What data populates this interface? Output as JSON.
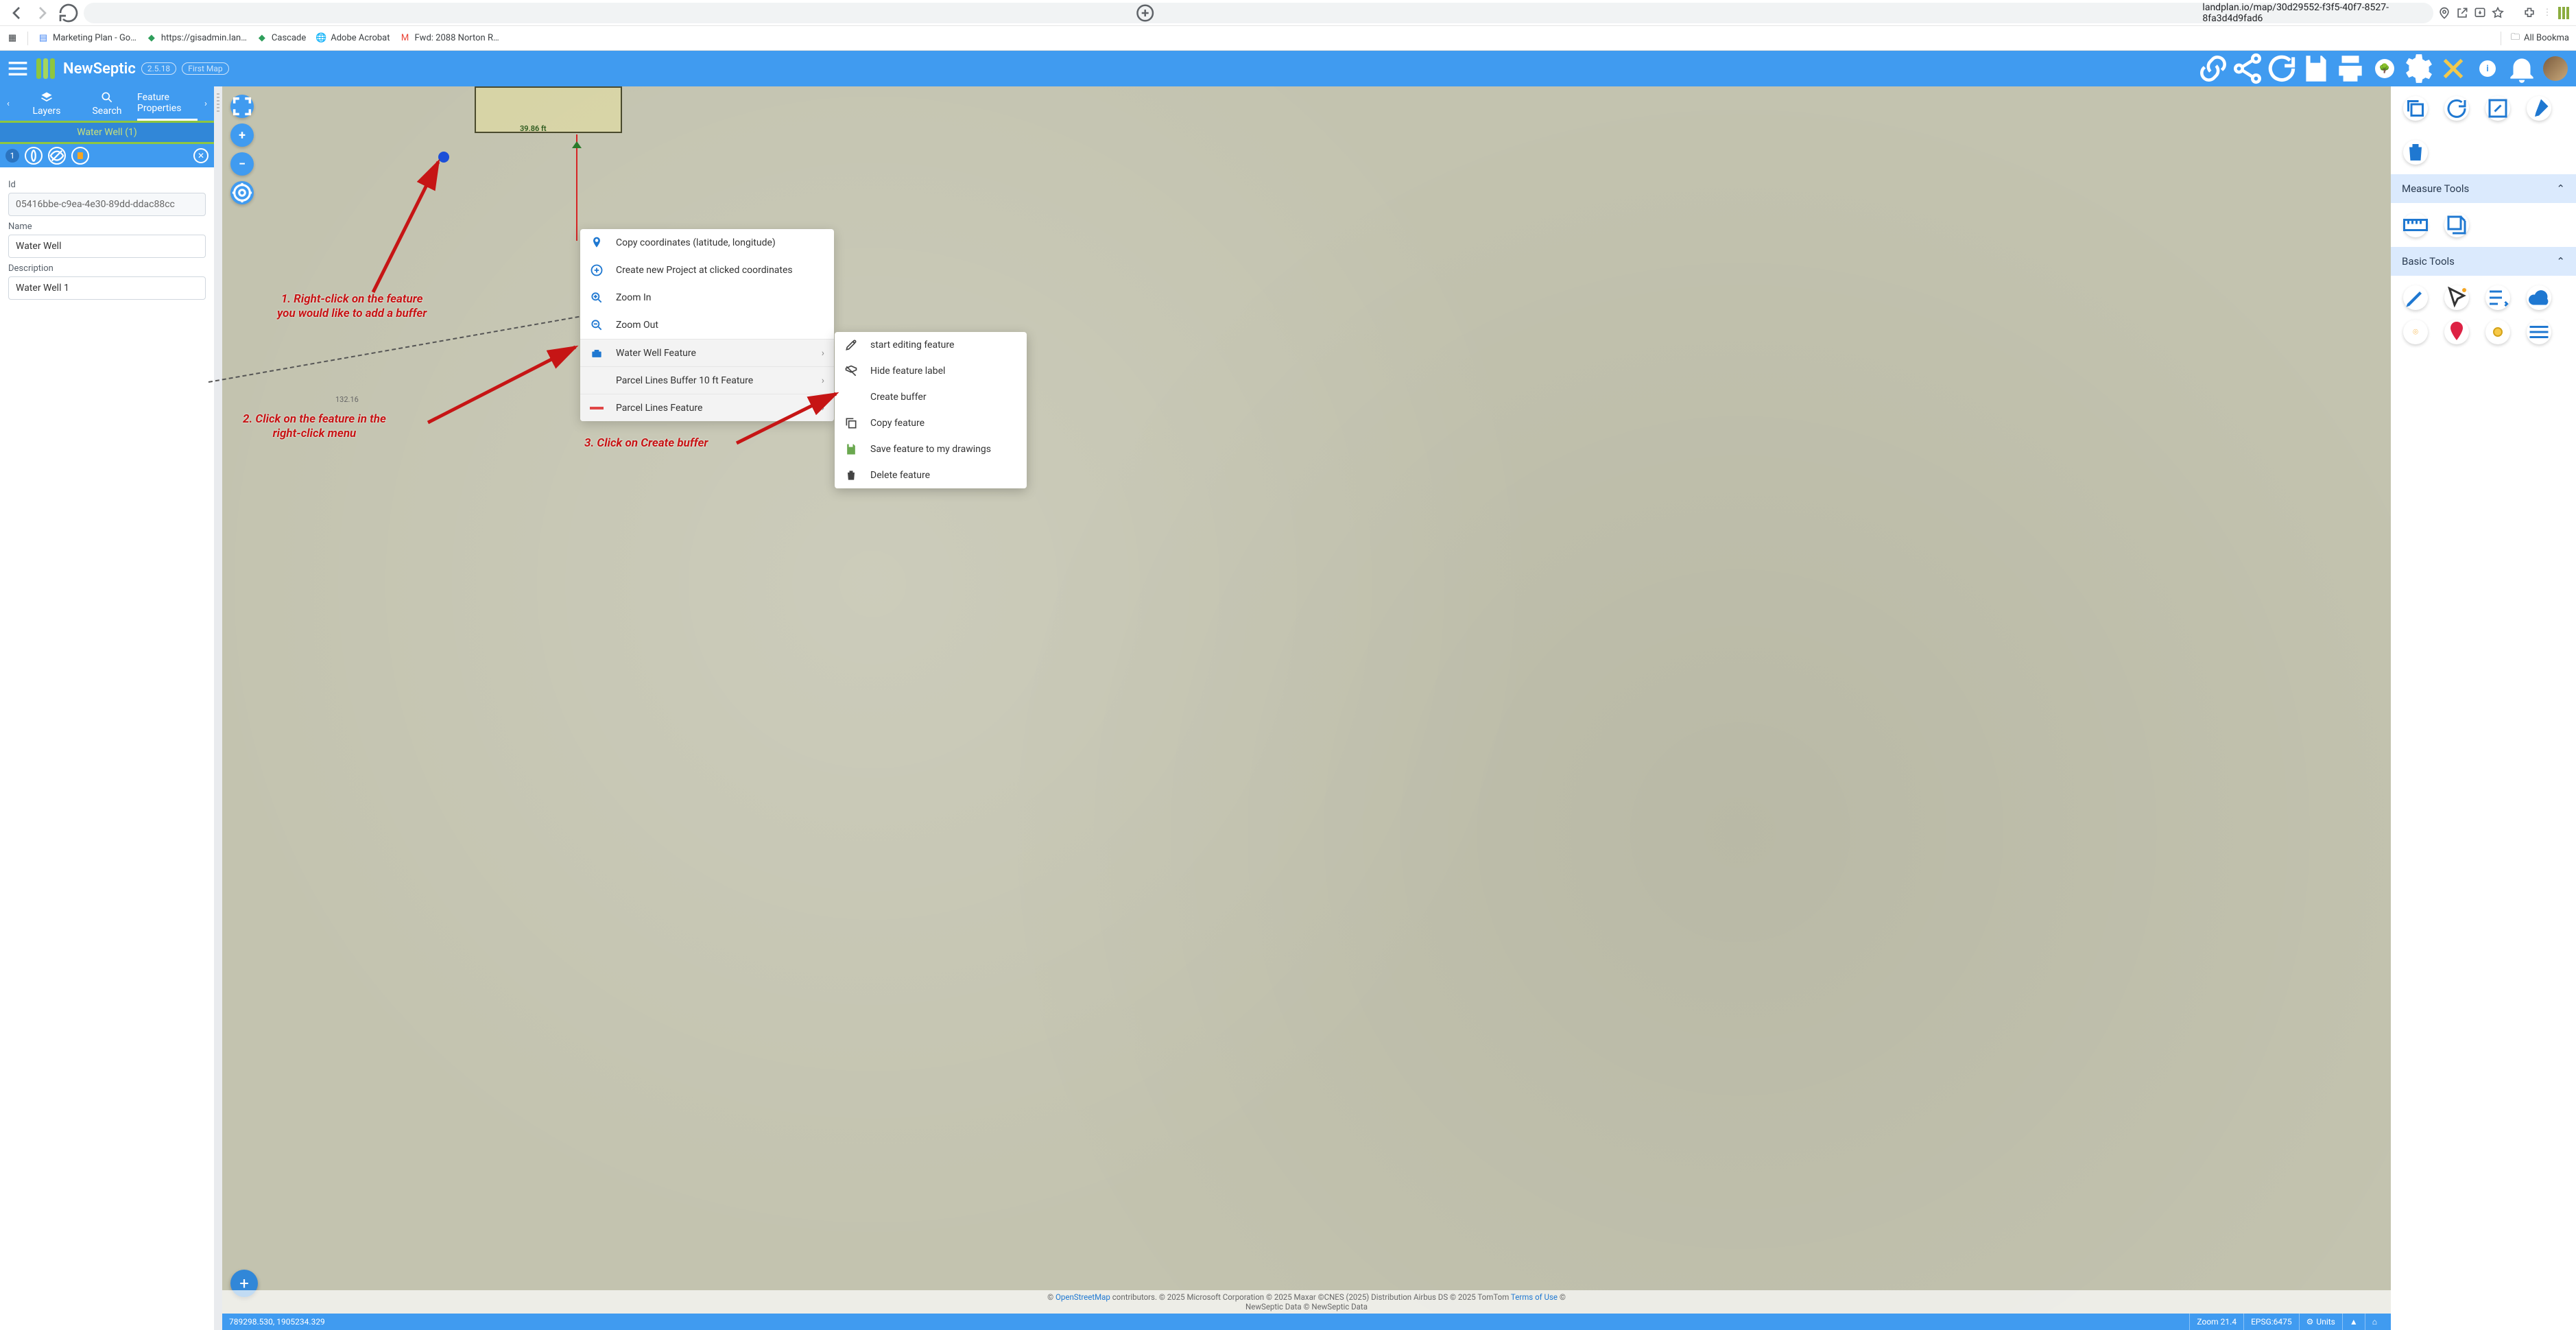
{
  "browser": {
    "url": "landplan.io/map/30d29552-f3f5-40f7-8527-8fa3d4d9fad6",
    "bookmarks": [
      {
        "label": "Marketing Plan - Go…",
        "icon": "docs"
      },
      {
        "label": "https://gisadmin.lan…",
        "icon": "globe-green"
      },
      {
        "label": "Cascade",
        "icon": "globe-green"
      },
      {
        "label": "Adobe Acrobat",
        "icon": "globe"
      },
      {
        "label": "Fwd: 2088 Norton R…",
        "icon": "gmail"
      }
    ],
    "all_bookmarks": "All Bookma"
  },
  "header": {
    "app": "NewSeptic",
    "version": "2.5.18",
    "map_chip": "First Map",
    "buttons": [
      "link",
      "share",
      "refresh",
      "save",
      "print",
      "tree",
      "settings",
      "tools",
      "info",
      "bell"
    ]
  },
  "sidebar": {
    "tabs": {
      "layers": "Layers",
      "search": "Search",
      "props": "Feature Properties"
    },
    "active": "Feature Properties",
    "feature_title": "Water Well (1)",
    "badge": "1",
    "fields": {
      "id_label": "Id",
      "id_value": "05416bbe-c9ea-4e30-89dd-ddac88cc",
      "name_label": "Name",
      "name_value": "Water Well",
      "desc_label": "Description",
      "desc_value": "Water Well 1"
    }
  },
  "map": {
    "dim_label": "39.86 ft",
    "dash_label": "132.16",
    "ctx": [
      {
        "icon": "pin",
        "label": "Copy coordinates (latitude, longitude)"
      },
      {
        "icon": "plus-circle",
        "label": "Create new Project at clicked coordinates"
      },
      {
        "icon": "zoom-in",
        "label": "Zoom In"
      },
      {
        "icon": "zoom-out",
        "label": "Zoom Out"
      },
      {
        "icon": "toolbox",
        "label": "Water Well Feature",
        "sub": true
      },
      {
        "icon": "swatch-dash",
        "label": "Parcel Lines Buffer 10 ft Feature",
        "sub": true
      },
      {
        "icon": "swatch-red",
        "label": "Parcel Lines Feature",
        "sub": true
      }
    ],
    "submenu": [
      {
        "icon": "edit-node",
        "label": "start editing feature"
      },
      {
        "icon": "label-off",
        "label": "Hide feature label"
      },
      {
        "icon": "buffer",
        "label": "Create buffer"
      },
      {
        "icon": "copy",
        "label": "Copy feature"
      },
      {
        "icon": "save",
        "label": "Save feature to my drawings"
      },
      {
        "icon": "trash",
        "label": "Delete feature"
      }
    ],
    "annotations": {
      "a1_l1": "1. Right-click on the feature",
      "a1_l2": "you would like to add a buffer",
      "a2_l1": "2. Click on the feature in the",
      "a2_l2": "right-click menu",
      "a3": "3. Click on Create buffer"
    },
    "attribution": "© OpenStreetMap contributors. © 2025 Microsoft Corporation © 2025 Maxar ©CNES (2025) Distribution Airbus DS © 2025 TomTom Terms of Use © NewSeptic Data © NewSeptic Data",
    "attribution_link": "OpenStreetMap"
  },
  "right": {
    "measure": "Measure Tools",
    "basic": "Basic Tools"
  },
  "status": {
    "coords": "789298.530, 1905234.329",
    "zoom": "Zoom 21.4",
    "epsg": "EPSG:6475",
    "units": "Units"
  }
}
